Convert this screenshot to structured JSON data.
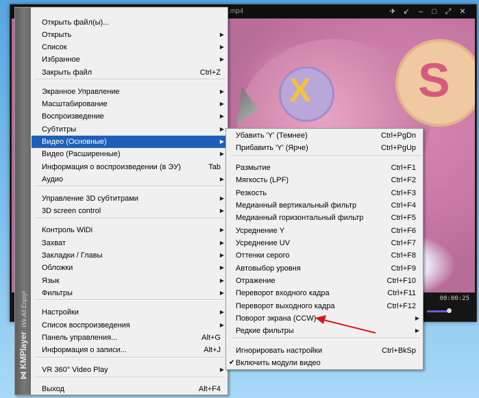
{
  "window": {
    "title_fragment": ".mp4",
    "time": "00:00:25"
  },
  "brand": {
    "logo_text": "KMPlayer",
    "slogan": "We All Enjoy!"
  },
  "main_menu": {
    "items": [
      {
        "label": "Открыть файл(ы)...",
        "shortcut": "",
        "submenu": false
      },
      {
        "label": "Открыть",
        "shortcut": "",
        "submenu": true
      },
      {
        "label": "Список",
        "shortcut": "",
        "submenu": true
      },
      {
        "label": "Избранное",
        "shortcut": "",
        "submenu": true
      },
      {
        "label": "Закрыть файл",
        "shortcut": "Ctrl+Z",
        "submenu": false
      },
      {
        "label": "Экранное Управление",
        "shortcut": "",
        "submenu": true
      },
      {
        "label": "Масштабирование",
        "shortcut": "",
        "submenu": true
      },
      {
        "label": "Воспроизведение",
        "shortcut": "",
        "submenu": true
      },
      {
        "label": "Субтитры",
        "shortcut": "",
        "submenu": true
      },
      {
        "label": "Видео (Основные)",
        "shortcut": "",
        "submenu": true
      },
      {
        "label": "Видео (Расширенные)",
        "shortcut": "",
        "submenu": true
      },
      {
        "label": "Информация о воспроизведении (в ЭУ)",
        "shortcut": "Tab",
        "submenu": false
      },
      {
        "label": "Аудио",
        "shortcut": "",
        "submenu": true
      },
      {
        "label": "Управление 3D субтитрами",
        "shortcut": "",
        "submenu": true
      },
      {
        "label": "3D screen control",
        "shortcut": "",
        "submenu": true
      },
      {
        "label": "Контроль WiDi",
        "shortcut": "",
        "submenu": true
      },
      {
        "label": "Захват",
        "shortcut": "",
        "submenu": true
      },
      {
        "label": "Закладки / Главы",
        "shortcut": "",
        "submenu": true
      },
      {
        "label": "Обложки",
        "shortcut": "",
        "submenu": true
      },
      {
        "label": "Язык",
        "shortcut": "",
        "submenu": true
      },
      {
        "label": "Фильтры",
        "shortcut": "",
        "submenu": true
      },
      {
        "label": "Настройки",
        "shortcut": "",
        "submenu": true
      },
      {
        "label": "Список воспроизведения",
        "shortcut": "",
        "submenu": true
      },
      {
        "label": "Панель управления...",
        "shortcut": "Alt+G",
        "submenu": false
      },
      {
        "label": "Информация о записи...",
        "shortcut": "Alt+J",
        "submenu": false
      },
      {
        "label": "VR 360° Video Play",
        "shortcut": "",
        "submenu": true
      },
      {
        "label": "Выход",
        "shortcut": "Alt+F4",
        "submenu": false
      }
    ]
  },
  "video_submenu": {
    "items": [
      {
        "label": "Убавить 'Y' (Темнее)",
        "shortcut": "Ctrl+PgDn",
        "submenu": false,
        "checked": false
      },
      {
        "label": "Прибавить 'Y' (Ярче)",
        "shortcut": "Ctrl+PgUp",
        "submenu": false,
        "checked": false
      },
      {
        "label": "Размытие",
        "shortcut": "Ctrl+F1",
        "submenu": false,
        "checked": false
      },
      {
        "label": "Мягкость (LPF)",
        "shortcut": "Ctrl+F2",
        "submenu": false,
        "checked": false
      },
      {
        "label": "Резкость",
        "shortcut": "Ctrl+F3",
        "submenu": false,
        "checked": false
      },
      {
        "label": "Медианный вертикальный фильтр",
        "shortcut": "Ctrl+F4",
        "submenu": false,
        "checked": false
      },
      {
        "label": "Медианный горизонтальный фильтр",
        "shortcut": "Ctrl+F5",
        "submenu": false,
        "checked": false
      },
      {
        "label": "Усреднение Y",
        "shortcut": "Ctrl+F6",
        "submenu": false,
        "checked": false
      },
      {
        "label": "Усреднение UV",
        "shortcut": "Ctrl+F7",
        "submenu": false,
        "checked": false
      },
      {
        "label": "Оттенки серого",
        "shortcut": "Ctrl+F8",
        "submenu": false,
        "checked": false
      },
      {
        "label": "Автовыбор уровня",
        "shortcut": "Ctrl+F9",
        "submenu": false,
        "checked": false
      },
      {
        "label": "Отражение",
        "shortcut": "Ctrl+F10",
        "submenu": false,
        "checked": false
      },
      {
        "label": "Переворот входного кадра",
        "shortcut": "Ctrl+F11",
        "submenu": false,
        "checked": false
      },
      {
        "label": "Переворот выходного кадра",
        "shortcut": "Ctrl+F12",
        "submenu": false,
        "checked": false
      },
      {
        "label": "Поворот экрана (CCW)",
        "shortcut": "",
        "submenu": true,
        "checked": false
      },
      {
        "label": "Редкие фильтры",
        "shortcut": "",
        "submenu": true,
        "checked": false
      },
      {
        "label": "Игнорировать настройки",
        "shortcut": "Ctrl+BkSp",
        "submenu": false,
        "checked": false
      },
      {
        "label": "Включить модули видео",
        "shortcut": "",
        "submenu": false,
        "checked": true
      }
    ]
  },
  "colors": {
    "highlight": "#1f5fb8",
    "annotation_arrow": "#d8161b"
  }
}
